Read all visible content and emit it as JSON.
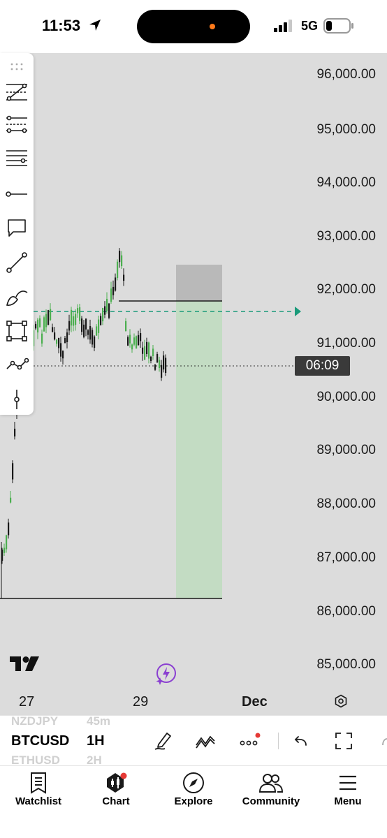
{
  "status_bar": {
    "time": "11:53",
    "network": "5G",
    "icons": [
      "location-arrow-icon",
      "signal-icon",
      "battery-icon"
    ]
  },
  "chart": {
    "price_axis": [
      "96,000.00",
      "95,000.00",
      "94,000.00",
      "93,000.00",
      "92,000.00",
      "91,000.00",
      "90,000.00",
      "89,000.00",
      "88,000.00",
      "87,000.00",
      "86,000.00",
      "85,000.00"
    ],
    "current_countdown": "06:09",
    "time_axis": [
      "27",
      "29",
      "Dec"
    ],
    "colors": {
      "background": "#dcdcdc",
      "up_candle": "#4caf50",
      "down_candle": "#1a1a1a",
      "target_zone": "#c3dcc3",
      "stop_zone": "#b9b9b9",
      "alert_line": "#1a9a7a"
    }
  },
  "drawing_tools": [
    "drag-handle-icon",
    "fib-retracement-icon",
    "fib-extension-icon",
    "horizontal-lines-icon",
    "horizontal-ray-icon",
    "callout-icon",
    "trend-line-icon",
    "brush-icon",
    "rectangle-icon",
    "path-icon",
    "vertical-line-icon"
  ],
  "symbol_bar": {
    "prev_symbol": "NZDJPY",
    "prev_interval": "45m",
    "symbol": "BTCUSD",
    "interval": "1H",
    "next_symbol": "ETHUSD",
    "next_interval": "2H"
  },
  "bottom_nav": [
    {
      "label": "Watchlist",
      "icon": "watchlist-icon"
    },
    {
      "label": "Chart",
      "icon": "chart-icon"
    },
    {
      "label": "Explore",
      "icon": "compass-icon"
    },
    {
      "label": "Community",
      "icon": "community-icon"
    },
    {
      "label": "Menu",
      "icon": "menu-icon"
    }
  ]
}
